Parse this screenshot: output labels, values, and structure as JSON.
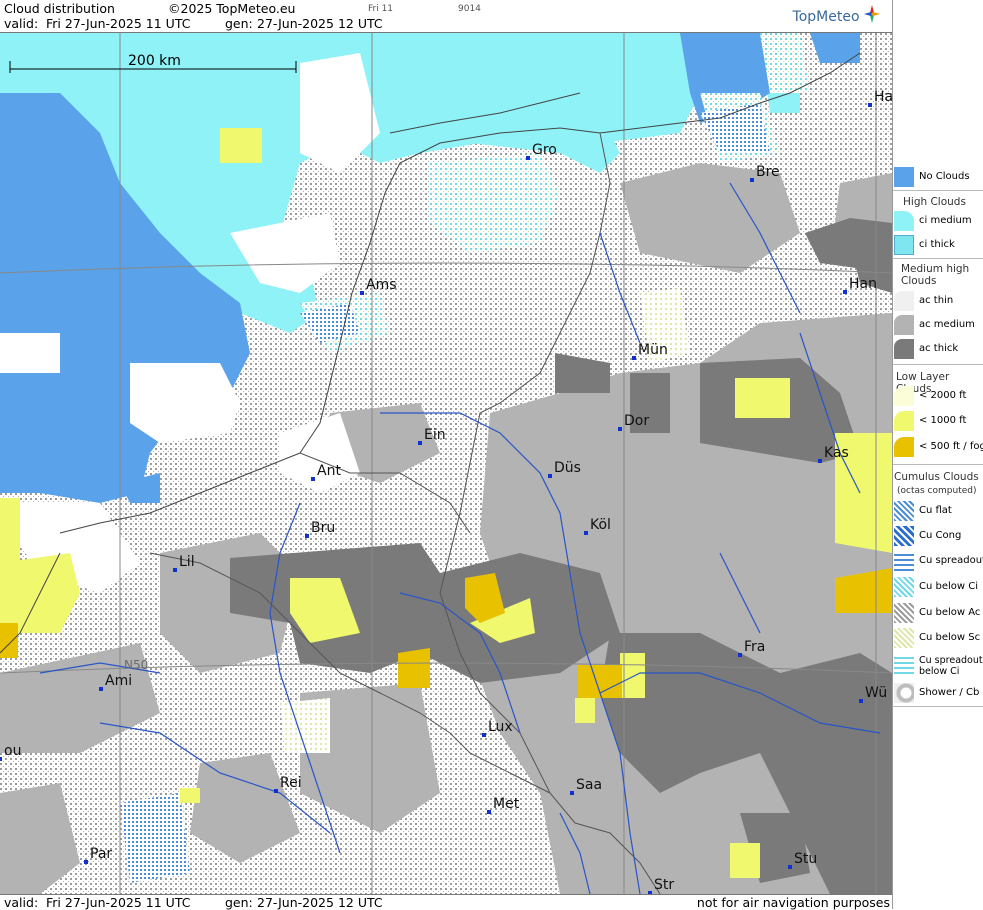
{
  "header": {
    "product": "Cloud distribution",
    "copyright": "©2025 TopMeteo.eu",
    "valid_label": "valid:",
    "valid_value": "Fri  27-Jun-2025  11 UTC",
    "gen_label": "gen:",
    "gen_value": "27-Jun-2025 12 UTC",
    "day_code": "Fri 11",
    "run_code": "9014",
    "logo": "TopMeteo"
  },
  "footer": {
    "valid_label": "valid:",
    "valid_value": "Fri  27-Jun-2025  11 UTC",
    "gen_label": "gen:",
    "gen_value": "27-Jun-2025 12 UTC",
    "disclaimer": "not for air navigation purposes"
  },
  "map": {
    "scale_label": "200 km",
    "graticule_label": "N50",
    "cities": [
      "Ha",
      "Gro",
      "Bre",
      "Ams",
      "Han",
      "Mün",
      "Dor",
      "Ein",
      "Kas",
      "Ant",
      "Düs",
      "Bru",
      "Köl",
      "Lil",
      "Fra",
      "Ami",
      "Wü",
      "Lux",
      "ou",
      "Rei",
      "Saa",
      "Met",
      "Par",
      "Stu",
      "Str"
    ]
  },
  "legend": {
    "no_clouds": "No Clouds",
    "high_head": "High Clouds",
    "ci_medium": "ci medium",
    "ci_thick": "ci thick",
    "medium_head": "Medium high Clouds",
    "ac_thin": "ac thin",
    "ac_medium": "ac medium",
    "ac_thick": "ac thick",
    "low_head": "Low Layer Clouds",
    "low_2000": "< 2000 ft",
    "low_1000": "< 1000 ft",
    "low_500": "< 500 ft / fog",
    "cu_head": "Cumulus Clouds",
    "cu_sub": "(octas computed)",
    "cu_flat": "Cu flat",
    "cu_cong": "Cu Cong",
    "cu_spread": "Cu spreadout",
    "cu_below_ci": "Cu below Ci",
    "cu_below_ac": "Cu below Ac",
    "cu_below_sc": "Cu below Sc",
    "cu_spread_ci": "Cu spreadout below Ci",
    "shower": "Shower / Cb"
  },
  "colors": {
    "no_clouds": "#5aa3ea",
    "ci": "#8ef2f7",
    "ac_medium": "#b3b3b3",
    "ac_thick": "#7a7a7a",
    "low_1000": "#f0f86e",
    "low_500": "#e8c100",
    "river": "#2a55c8",
    "border": "#444444"
  }
}
